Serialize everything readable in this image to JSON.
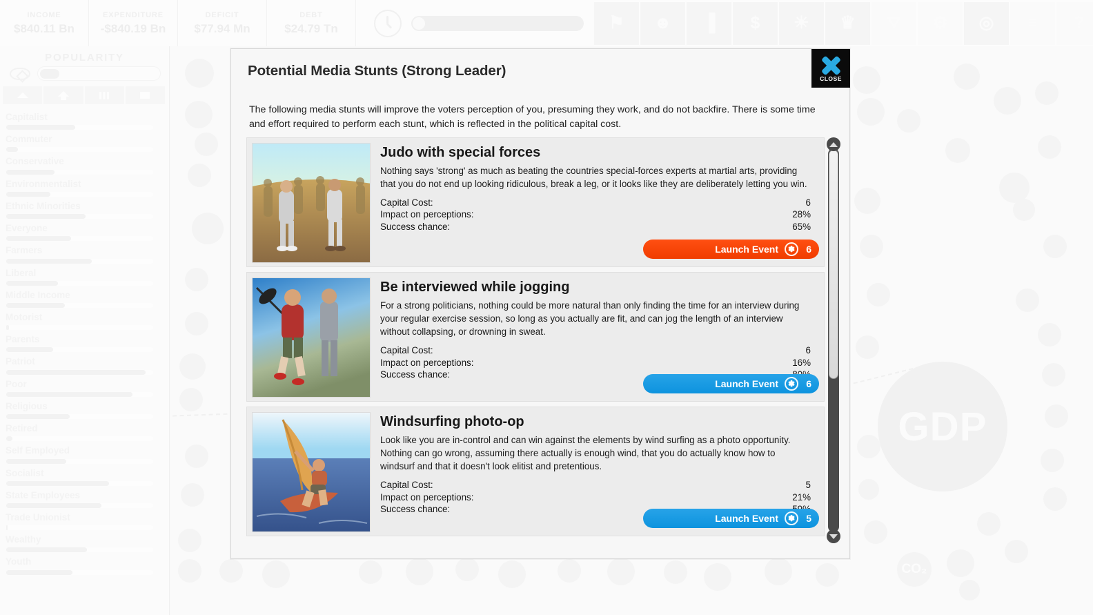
{
  "topbar": {
    "stats": [
      {
        "label": "INCOME",
        "value": "$840.11 Bn"
      },
      {
        "label": "EXPENDITURE",
        "value": "-$840.19 Bn"
      },
      {
        "label": "DEFICIT",
        "value": "$77.94 Mn"
      },
      {
        "label": "DEBT",
        "value": "$24.79 Tn"
      }
    ],
    "clock_icon": "clock-icon",
    "speed_slider": "game-speed-slider",
    "tools": [
      {
        "name": "tool-podium",
        "glyph": "⚑"
      },
      {
        "name": "tool-voters",
        "glyph": "☻"
      },
      {
        "name": "tool-statistics",
        "glyph": "▐"
      },
      {
        "name": "tool-finance",
        "glyph": "$"
      },
      {
        "name": "tool-ideas",
        "glyph": "☀"
      },
      {
        "name": "tool-achievements",
        "glyph": "♛"
      },
      {
        "name": "tool-groups",
        "glyph": "⛛"
      },
      {
        "name": "tool-settings",
        "glyph": "⚙"
      },
      {
        "name": "tool-targets",
        "glyph": "◎"
      },
      {
        "name": "tool-reports",
        "glyph": "≡"
      },
      {
        "name": "tool-help",
        "glyph": "?"
      }
    ]
  },
  "popularity": {
    "title": "POPULARITY",
    "groups": [
      {
        "name": "Capitalist",
        "value": 47
      },
      {
        "name": "Commuter",
        "value": 8
      },
      {
        "name": "Conservative",
        "value": 33
      },
      {
        "name": "Environmentalist",
        "value": 30
      },
      {
        "name": "Ethnic Minorities",
        "value": 54
      },
      {
        "name": "Everyone",
        "value": 44
      },
      {
        "name": "Farmers",
        "value": 58
      },
      {
        "name": "Liberal",
        "value": 35
      },
      {
        "name": "Middle Income",
        "value": 40
      },
      {
        "name": "Motorist",
        "value": 2
      },
      {
        "name": "Parents",
        "value": 32
      },
      {
        "name": "Patriot",
        "value": 95
      },
      {
        "name": "Poor",
        "value": 86
      },
      {
        "name": "Religious",
        "value": 43
      },
      {
        "name": "Retired",
        "value": 4
      },
      {
        "name": "Self Employed",
        "value": 41
      },
      {
        "name": "Socialist",
        "value": 70
      },
      {
        "name": "State Employees",
        "value": 65
      },
      {
        "name": "Trade Unionist",
        "value": 1
      },
      {
        "name": "Wealthy",
        "value": 55
      },
      {
        "name": "Youth",
        "value": 45
      }
    ]
  },
  "background": {
    "gdp_label": "GDP",
    "co2_label": "CO₂"
  },
  "modal": {
    "title": "Potential Media Stunts (Strong Leader)",
    "description": "The following media stunts will improve the voters perception of you, presuming they work, and do not backfire. There is some time and effort required to perform each stunt, which is reflected in the political capital cost.",
    "close_label": "CLOSE",
    "stat_labels": {
      "capital_cost": "Capital Cost:",
      "impact": "Impact on perceptions:",
      "success": "Success chance:"
    },
    "launch_label": "Launch Event",
    "accent_orange": "#f6400a",
    "accent_blue": "#1896e0",
    "stunts": [
      {
        "title": "Judo with special forces",
        "description": "Nothing says 'strong' as much as beating the countries special-forces experts at martial arts, providing that you do not end up looking ridiculous, break a leg, or it looks like they are deliberately letting you win.",
        "capital_cost": "6",
        "impact": "28%",
        "success": "65%",
        "button_cost": "6",
        "button_style": "orange",
        "image_name": "judo-with-special-forces-image"
      },
      {
        "title": "Be interviewed while jogging",
        "description": "For a strong politicians, nothing could be more natural than only finding the time for an interview during your regular exercise session, so long as you actually are fit, and can jog the length of an interview without collapsing, or drowning in sweat.",
        "capital_cost": "6",
        "impact": "16%",
        "success": "80%",
        "button_cost": "6",
        "button_style": "blue",
        "image_name": "be-interviewed-while-jogging-image"
      },
      {
        "title": "Windsurfing photo-op",
        "description": "Look like you are in-control and can win against the elements by wind surfing as a photo opportunity. Nothing can go wrong, assuming there actually is enough wind, that you do actually know how to windsurf and that it doesn't look elitist and pretentious.",
        "capital_cost": "5",
        "impact": "21%",
        "success": "59%",
        "button_cost": "5",
        "button_style": "blue",
        "image_name": "windsurfing-photo-op-image"
      }
    ]
  }
}
